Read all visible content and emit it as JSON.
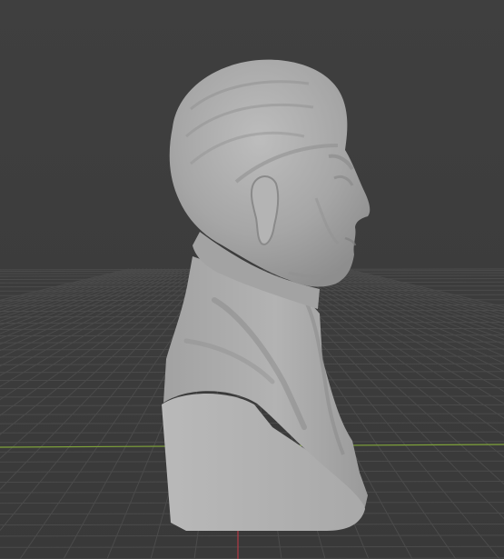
{
  "app": {
    "view": "3D Viewport",
    "shading": "solid"
  },
  "scene": {
    "object": "bust-sculpture",
    "floor_grid": true,
    "x_axis_color": "#7fa33a",
    "y_axis_color": "#b23a45",
    "grid_color": "#4b4b4b",
    "background_color": "#3d3d3d",
    "object_color": "#a7a7a7"
  }
}
